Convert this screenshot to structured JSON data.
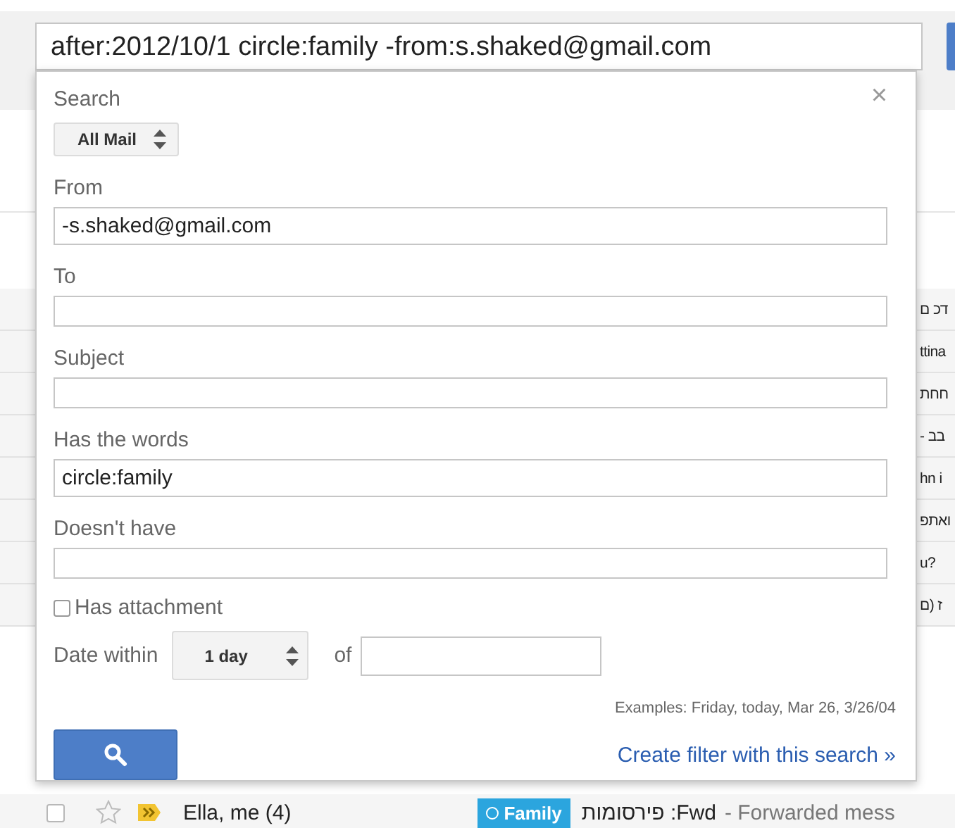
{
  "search_bar": {
    "value": "after:2012/10/1 circle:family -from:s.shaked@gmail.com"
  },
  "search_dialog": {
    "scope_label": "Search",
    "scope": "All Mail",
    "close": "×",
    "fields": [
      {
        "label": "From",
        "value": "-s.shaked@gmail.com"
      },
      {
        "label": "To"
      },
      {
        "label": "Subject"
      },
      {
        "label": "Has the words",
        "value": "circle:family"
      },
      {
        "label": "Doesn't have"
      }
    ],
    "has_attachment": {
      "label": "Has attachment",
      "checked": false
    },
    "date_within": {
      "label": "Date within",
      "value": "1 day",
      "of_label": "of"
    },
    "examples": "Examples: Friday, today, Mar 26, 3/26/04",
    "create_filter_link": "Create filter with this search »"
  },
  "message_list": {
    "rows": [
      {
        "text": "ם כד"
      },
      {
        "text": "ttina"
      },
      {
        "text": "תחח"
      },
      {
        "text": "- בב"
      },
      {
        "text": "hn i"
      },
      {
        "text": "פתאו"
      },
      {
        "text": "u?"
      },
      {
        "text": "ם) ז"
      }
    ],
    "last_row": {
      "selected": false,
      "starred": false,
      "sender": "Ella, me (4)",
      "label": "Family",
      "subject": "Fwd: פירסומות",
      "snippet": "- Forwarded mess"
    }
  }
}
